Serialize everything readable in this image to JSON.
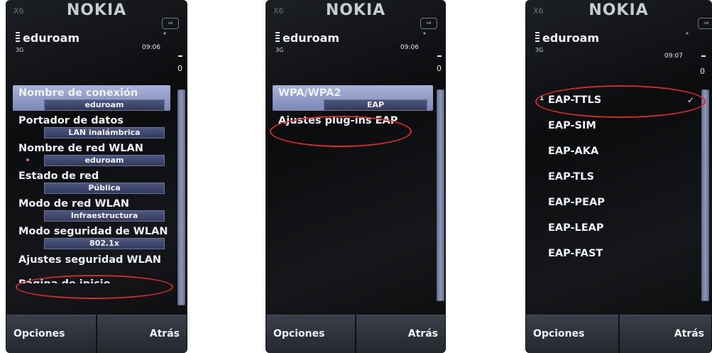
{
  "phone1": {
    "model": "X6",
    "brand": "NOKIA",
    "menu_icon": "arrow-key-icon",
    "title": "eduroam",
    "network": "3G",
    "time": "09:06",
    "signal_star": "*",
    "battery": "0",
    "items": [
      {
        "label": "Nombre de conexión",
        "value": "eduroam",
        "highlighted": true,
        "marked": true
      },
      {
        "label": "Portador de datos",
        "value": "LAN inalámbrica",
        "highlighted": false,
        "marked": false
      },
      {
        "label": "Nombre de red WLAN",
        "value": "eduroam",
        "highlighted": false,
        "marked": true
      },
      {
        "label": "Estado de red",
        "value": "Pública",
        "highlighted": false,
        "marked": false
      },
      {
        "label": "Modo de red WLAN",
        "value": "Infraestructura",
        "highlighted": false,
        "marked": false
      },
      {
        "label": "Modo seguridad de WLAN",
        "value": "802.1x",
        "highlighted": false,
        "marked": false
      },
      {
        "label": "Ajustes seguridad WLAN",
        "value": "",
        "highlighted": false,
        "marked": false
      },
      {
        "label": "Página de inicio",
        "value": "",
        "highlighted": false,
        "marked": false
      }
    ],
    "softkey_left": "Opciones",
    "softkey_right": "Atrás"
  },
  "phone2": {
    "model": "X6",
    "brand": "NOKIA",
    "menu_icon": "arrow-key-icon",
    "title": "eduroam",
    "network": "3G",
    "time": "09:06",
    "signal_star": "*",
    "battery": "0",
    "items": [
      {
        "label": "WPA/WPA2",
        "value": "EAP",
        "highlighted": true
      },
      {
        "label": "Ajustes plug-ins EAP",
        "value": "",
        "highlighted": false
      }
    ],
    "softkey_left": "Opciones",
    "softkey_right": "Atrás"
  },
  "phone3": {
    "model": "X6",
    "brand": "NOKIA",
    "menu_icon": "arrow-key-icon",
    "title": "eduroam",
    "network": "3G",
    "time": "09:07",
    "signal_star": "*",
    "battery": "0",
    "first_index": "1",
    "eap_items": [
      "EAP-TTLS",
      "EAP-SIM",
      "EAP-AKA",
      "EAP-TLS",
      "EAP-PEAP",
      "EAP-LEAP",
      "EAP-FAST"
    ],
    "checked_item": "EAP-TTLS",
    "check_glyph": "✓",
    "softkey_left": "Opciones",
    "softkey_right": "Atrás"
  },
  "colors": {
    "highlight": "#8f9ac8",
    "value_field": "#3f4870",
    "annotation_oval": "#d52a2a",
    "marker_dot": "#e060b8"
  }
}
